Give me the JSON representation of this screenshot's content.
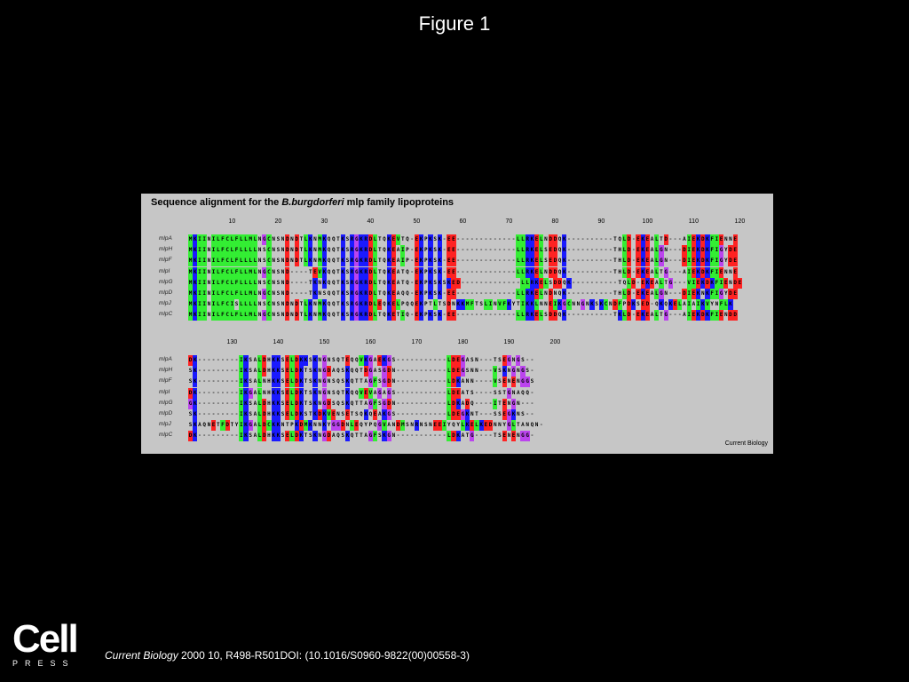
{
  "page": {
    "title": "Figure 1"
  },
  "figure": {
    "heading_prefix": "Sequence alignment for the ",
    "heading_species": "B.burgdorferi",
    "heading_suffix": " mlp family lipoproteins",
    "credit": "Current Biology",
    "colors": {
      "blue": "#1a1aff",
      "green": "#33ee33",
      "red": "#ff2222",
      "purple": "#bb44ee",
      "darkred": "#991111",
      "pink": "#ff66aa",
      "white": "#ffffff"
    },
    "blocks": [
      {
        "ticks": [
          "10",
          "20",
          "30",
          "40",
          "50",
          "60",
          "70",
          "80",
          "90",
          "100",
          "110",
          "120"
        ],
        "rows": [
          {
            "label": "mlpA",
            "seq": "MKIINILFCLFLLMLNGCNSNDNDTLKNMKQQTKSRGKRDLTQKEVTQ-EKPKSK-EE-------------LLRKELNDDQK----------TQLD-EKEALTD---AIEKDKFIENNE"
          },
          {
            "label": "mlpH",
            "seq": "MKIINILFCLFLLLLNSCNSNDNDTLKNMKQQTKSRGKRDLTQKEAIP-EKPKSK-EE-------------LLRKELSEDQK----------THLD-EKEALGN---DIEKDKFIGYDE"
          },
          {
            "label": "mlpF",
            "seq": "MKIINILFCLFLLLLNSCNSNDNDTLKNMKQQTKSRGKRDLTQKEAIP-EKPKSK-EE-------------LLRKELSEDQK----------THLD-EKEALGN---DIEKDKFIGYDE"
          },
          {
            "label": "mlpI",
            "seq": "MKIINILFCLFLLMLNGCNSND----TEVKQQTKSRGKRDLTQKEATQ-EKPKSK-EE-------------LLRKELNDDQK----------THLD-EKEALTG---AIEKDKFIENNE"
          },
          {
            "label": "mlpG",
            "seq": "MKIINILFCLFLLLLNSCNSND----TKNKQQTKSRGKRDLTQKEATQ-EKPKSKSKED-------------LLRKELSDDQK----------TQLD-EKEALTG---VIEKDKFIENDE"
          },
          {
            "label": "mlpD",
            "seq": "MKIINILFCLFLLMLNGCNSND----TKNSQQTKSRGKRDLTQKEAQQ-EKPKSK-EE-------------LLRKELNDNQK----------THLD-EKEALGN---DIEKNKFIGYDE"
          },
          {
            "label": "mlpJ",
            "seq": "MKIINILFCISLLLLNSCNSNDNDTLKNMKQQTKSRGKRDLEQKELPQQEKPTLTSDNKKMFTSLINVFKYTIKKLNNEIKGCNNGNKSKCNDFPDKSED-QKQKELAIAIKVYNFLK"
          },
          {
            "label": "mlpC",
            "seq": "MKIINILFCLFLLMLNGCNSNDNDTLKNMKQQTKSRGKRDLTQKETIQ-EKPKSK-EE-------------LLRKELSDDQK----------TKLD-EKEALTG---AIEKDKFIENDD"
          }
        ]
      },
      {
        "ticks": [
          "130",
          "140",
          "150",
          "160",
          "170",
          "180",
          "190",
          "200"
        ],
        "rows": [
          {
            "label": "mlpA",
            "seq": "DK---------IKSALDHKKSELDKKSKNGNSQTEQQVKGAEKGS-----------LDEGASN---TSEGNGS--"
          },
          {
            "label": "mlpH",
            "seq": "SK---------IKSALDHKKSELDKTSKNGDAQSKQQTDGASGDN-----------LDEGSNN---VSKNGNGS-"
          },
          {
            "label": "mlpF",
            "seq": "SK---------IKSALNHKKSELDKTSKNGNSQSKQTTAGFSGDN-----------LDKANN----VSENENGGS"
          },
          {
            "label": "mlpI",
            "seq": "DK---------IKGALNHKKSELDKTSKNGNSQTKQQVEVAGAGS-----------LDEATS----SSTGNAQQ-"
          },
          {
            "label": "mlpG",
            "seq": "GK---------IKSALDHKKSELDKTSKNGDSQSKQTTAGFSGDN-----------LDKADQ----ITENGN---"
          },
          {
            "label": "mlpD",
            "seq": "SK---------IKSALDHKKSELDKSTKDKVENSETSQKQEAKGS-----------LDEGKNT---SSEGKNS--"
          },
          {
            "label": "mlpJ",
            "seq": "SKAQNETFDTYIKGALDCKKNTPKDMKNNKYGGDNLEQYPQGVANDMSNRNSNEEIYQYLKELKEDNNYGLTANQN-"
          },
          {
            "label": "mlpC",
            "seq": "DK---------IKSALDHKKSELDKTSKNGDAQSKQTTAGFSKGN-----------LDKATG----TSENENGG-"
          }
        ]
      }
    ]
  },
  "footer": {
    "logo_word": "Cell",
    "logo_sub": "PRESS",
    "journal": "Current Biology",
    "citation": " 2000 10, R498-R501DOI: (10.1016/S0960-9822(00)00558-3)"
  }
}
